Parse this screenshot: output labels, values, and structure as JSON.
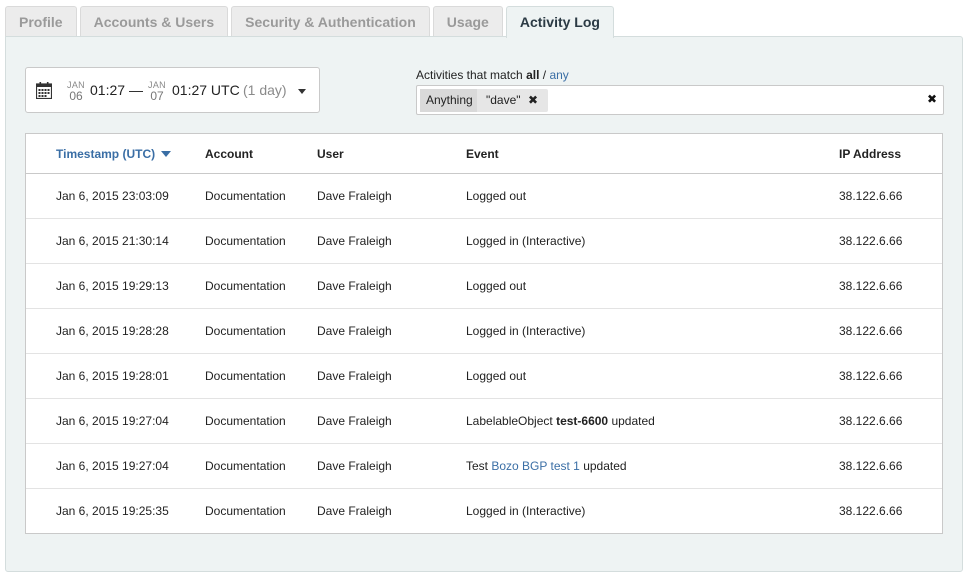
{
  "tabs": [
    {
      "label": "Profile",
      "active": false
    },
    {
      "label": "Accounts & Users",
      "active": false
    },
    {
      "label": "Security & Authentication",
      "active": false
    },
    {
      "label": "Usage",
      "active": false
    },
    {
      "label": "Activity Log",
      "active": true
    }
  ],
  "date_range": {
    "start_month": "JAN",
    "start_day": "06",
    "start_time": "01:27",
    "separator": "—",
    "end_month": "JAN",
    "end_day": "07",
    "end_time": "01:27 UTC",
    "duration": "(1 day)",
    "icon": "calendar-icon"
  },
  "filter": {
    "prefix": "Activities that match",
    "all": "all",
    "sep": "/",
    "any": "any",
    "chip_key": "Anything",
    "chip_value": "\"dave\"",
    "chip_remove": "✖",
    "clear": "✖"
  },
  "table": {
    "columns": {
      "timestamp": "Timestamp (UTC)",
      "account": "Account",
      "user": "User",
      "event": "Event",
      "ip": "IP Address"
    },
    "rows": [
      {
        "timestamp": "Jan 6, 2015 23:03:09",
        "account": "Documentation",
        "user": "Dave Fraleigh",
        "event": "Logged out",
        "ip": "38.122.6.66"
      },
      {
        "timestamp": "Jan 6, 2015 21:30:14",
        "account": "Documentation",
        "user": "Dave Fraleigh",
        "event": "Logged in (Interactive)",
        "ip": "38.122.6.66"
      },
      {
        "timestamp": "Jan 6, 2015 19:29:13",
        "account": "Documentation",
        "user": "Dave Fraleigh",
        "event": "Logged out",
        "ip": "38.122.6.66"
      },
      {
        "timestamp": "Jan 6, 2015 19:28:28",
        "account": "Documentation",
        "user": "Dave Fraleigh",
        "event": "Logged in (Interactive)",
        "ip": "38.122.6.66"
      },
      {
        "timestamp": "Jan 6, 2015 19:28:01",
        "account": "Documentation",
        "user": "Dave Fraleigh",
        "event": "Logged out",
        "ip": "38.122.6.66"
      },
      {
        "timestamp": "Jan 6, 2015 19:27:04",
        "account": "Documentation",
        "user": "Dave Fraleigh",
        "event_prefix": "LabelableObject",
        "event_bold": "test-6600",
        "event_suffix": "updated",
        "ip": "38.122.6.66"
      },
      {
        "timestamp": "Jan 6, 2015 19:27:04",
        "account": "Documentation",
        "user": "Dave Fraleigh",
        "event_prefix": "Test",
        "event_link": "Bozo BGP test 1",
        "event_suffix": "updated",
        "ip": "38.122.6.66"
      },
      {
        "timestamp": "Jan 6, 2015 19:25:35",
        "account": "Documentation",
        "user": "Dave Fraleigh",
        "event": "Logged in (Interactive)",
        "ip": "38.122.6.66"
      }
    ]
  },
  "colors": {
    "accent_link": "#3a6ea5",
    "panel_bg": "#eef3f3"
  }
}
